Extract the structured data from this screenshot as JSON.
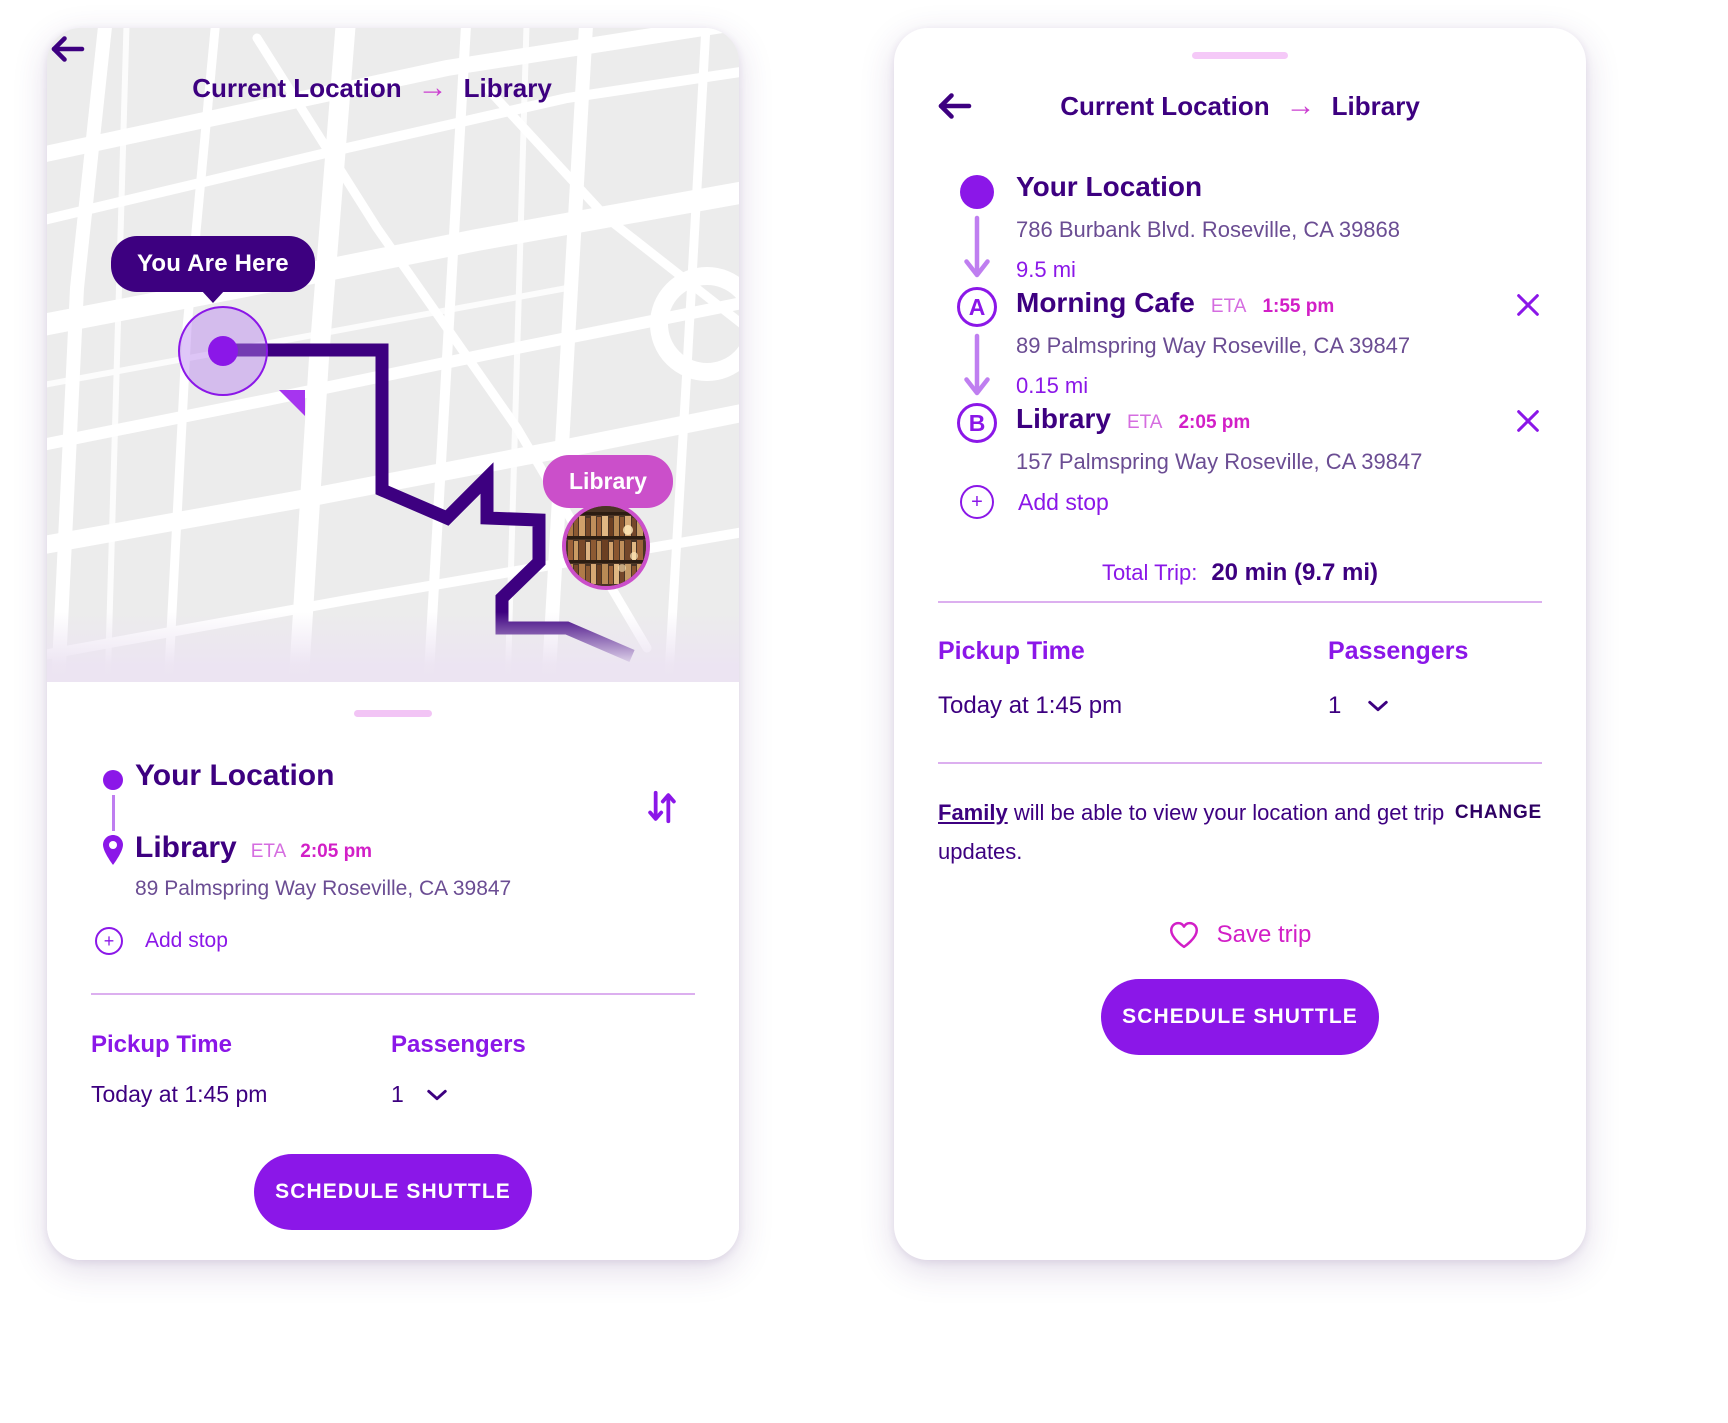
{
  "colors": {
    "accent": "#8b17e8",
    "dark_purple": "#3d0080",
    "magenta": "#d21fc7",
    "orchid": "#cb4fca",
    "light_purple": "#bf7ef0",
    "divider": "#dcafef"
  },
  "left_screen": {
    "header": {
      "back_icon": "back-arrow-icon",
      "origin": "Current Location",
      "arrow": "→",
      "destination": "Library"
    },
    "map": {
      "you_are_here_label": "You Are Here",
      "library_label": "Library",
      "you_marker_icon": "current-location-dot-icon",
      "library_photo_icon": "library-bookshelf-photo"
    },
    "route": {
      "origin_label": "Your Location",
      "destination_label": "Library",
      "eta_label": "ETA",
      "eta_value": "2:05 pm",
      "destination_address": "89 Palmspring Way Roseville, CA 39847",
      "swap_icon": "swap-arrows-icon",
      "add_stop_label": "Add stop",
      "add_stop_icon": "plus-circle-icon"
    },
    "fields": {
      "pickup_time_label": "Pickup Time",
      "pickup_time_value": "Today at 1:45 pm",
      "passengers_label": "Passengers",
      "passengers_value": "1",
      "passengers_chevron": "chevron-down-icon"
    },
    "cta_label": "SCHEDULE SHUTTLE"
  },
  "right_screen": {
    "header": {
      "back_icon": "back-arrow-icon",
      "origin": "Current Location",
      "arrow": "→",
      "destination": "Library"
    },
    "stops": [
      {
        "marker": "dot",
        "title": "Your Location",
        "address": "786 Burbank Blvd. Roseville, CA 39868",
        "eta_label": "",
        "eta_value": "",
        "distance_to_next": "9.5 mi",
        "removable": false
      },
      {
        "marker": "A",
        "title": "Morning Cafe",
        "address": "89 Palmspring Way Roseville, CA 39847",
        "eta_label": "ETA",
        "eta_value": "1:55 pm",
        "distance_to_next": "0.15 mi",
        "removable": true
      },
      {
        "marker": "B",
        "title": "Library",
        "address": "157 Palmspring Way Roseville, CA 39847",
        "eta_label": "ETA",
        "eta_value": "2:05 pm",
        "distance_to_next": "",
        "removable": true
      }
    ],
    "add_stop_label": "Add stop",
    "add_stop_icon": "plus-circle-icon",
    "total": {
      "label": "Total Trip:",
      "value": "20 min (9.7 mi)"
    },
    "fields": {
      "pickup_time_label": "Pickup Time",
      "pickup_time_value": "Today at 1:45 pm",
      "passengers_label": "Passengers",
      "passengers_value": "1",
      "passengers_chevron": "chevron-down-icon"
    },
    "share": {
      "audience": "Family",
      "text_rest": " will be able to view your location and get trip updates.",
      "change_label": "CHANGE"
    },
    "save_trip": {
      "icon": "heart-outline-icon",
      "label": "Save trip"
    },
    "cta_label": "SCHEDULE SHUTTLE"
  }
}
